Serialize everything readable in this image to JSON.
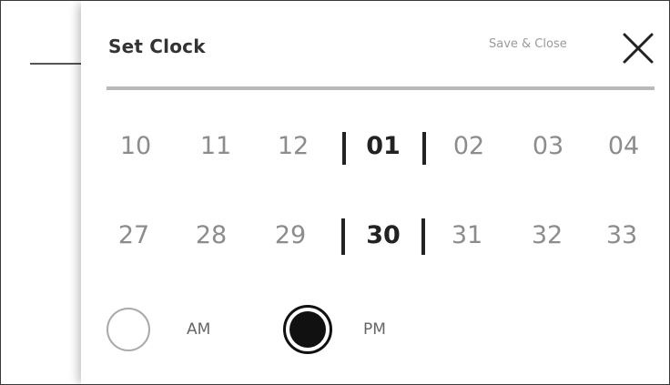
{
  "dialog": {
    "title": "Set Clock",
    "save_close_label": "Save & Close",
    "close_icon": "close-icon"
  },
  "hours": {
    "values": [
      "10",
      "11",
      "12",
      "01",
      "02",
      "03",
      "04"
    ],
    "selected": "01"
  },
  "minutes": {
    "values": [
      "27",
      "28",
      "29",
      "30",
      "31",
      "32",
      "33"
    ],
    "selected": "30"
  },
  "meridiem": {
    "am_label": "AM",
    "pm_label": "PM",
    "selected": "PM"
  },
  "colors": {
    "selected_text": "#222222",
    "unselected_text": "#8c8c8c",
    "divider": "#b9b9b9"
  }
}
